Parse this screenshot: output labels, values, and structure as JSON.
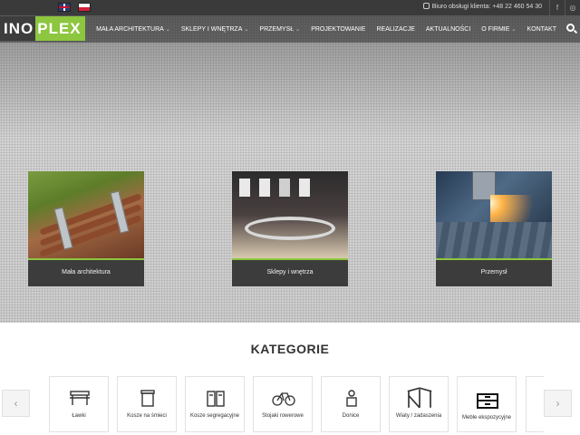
{
  "topbar": {
    "hotline_label": "Biuro obsługi klienta:",
    "hotline_number": "+48 22 460 54 30",
    "social": [
      "f",
      "◎"
    ]
  },
  "logo": {
    "part1": "INO",
    "part2": "PLEX"
  },
  "nav": {
    "items": [
      {
        "label": "Mała architektura",
        "has_dropdown": true
      },
      {
        "label": "Sklepy i wnętrza",
        "has_dropdown": true
      },
      {
        "label": "Przemysł",
        "has_dropdown": true
      },
      {
        "label": "Projektowanie",
        "has_dropdown": false
      },
      {
        "label": "Realizacje",
        "has_dropdown": false
      },
      {
        "label": "Aktualności",
        "has_dropdown": false
      },
      {
        "label": "O firmie",
        "has_dropdown": true
      },
      {
        "label": "Kontakt",
        "has_dropdown": false
      }
    ]
  },
  "hero": {
    "cards": [
      {
        "label": "Mała architektura"
      },
      {
        "label": "Sklepy i wnętrza"
      },
      {
        "label": "Przemysł"
      }
    ]
  },
  "categories": {
    "title": "KATEGORIE",
    "items": [
      {
        "label": "Ławki",
        "icon": "bench-icon"
      },
      {
        "label": "Kosze na śmieci",
        "icon": "trash-bin-icon"
      },
      {
        "label": "Kosze segregacyjne",
        "icon": "recycling-bins-icon"
      },
      {
        "label": "Stojaki rowerowe",
        "icon": "bicycle-icon"
      },
      {
        "label": "Donice",
        "icon": "planter-icon"
      },
      {
        "label": "Wiaty / zadaszenia",
        "icon": "shelter-icon"
      },
      {
        "label": "Meble ekspozycyjne",
        "icon": "display-furniture-icon"
      }
    ],
    "prev_label": "‹",
    "next_label": "›"
  },
  "colors": {
    "accent": "#8dc63f",
    "topbar": "#3a3a3a",
    "caption_bg": "#3c3c3c"
  }
}
